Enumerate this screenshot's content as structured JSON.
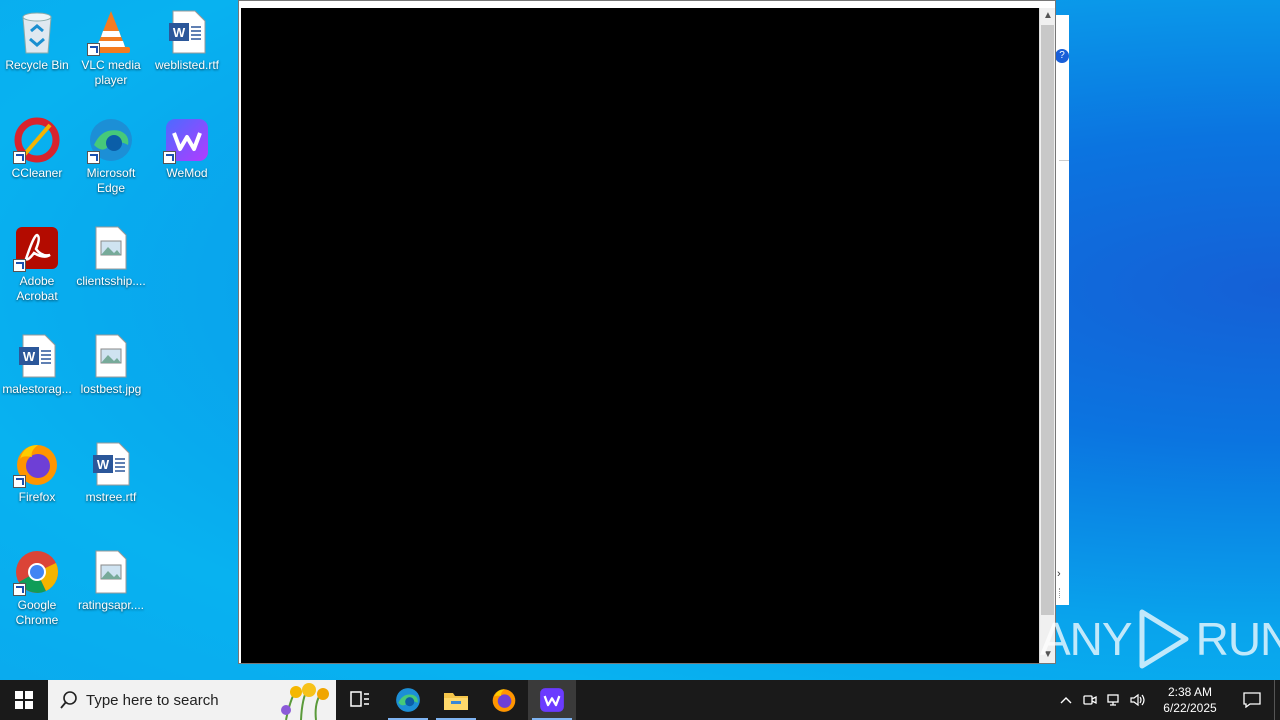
{
  "desktop": {
    "icons": [
      {
        "label": "Recycle Bin",
        "icon": "recycle-bin-icon"
      },
      {
        "label": "VLC media player",
        "icon": "vlc-icon"
      },
      {
        "label": "weblisted.rtf",
        "icon": "word-doc-icon"
      },
      {
        "label": "CCleaner",
        "icon": "ccleaner-icon"
      },
      {
        "label": "Microsoft Edge",
        "icon": "edge-icon"
      },
      {
        "label": "WeMod",
        "icon": "wemod-icon"
      },
      {
        "label": "Adobe Acrobat",
        "icon": "acrobat-icon"
      },
      {
        "label": "clientsship....",
        "icon": "image-file-icon"
      },
      {
        "label": "malestorag...",
        "icon": "word-doc-icon"
      },
      {
        "label": "lostbest.jpg",
        "icon": "image-file-icon"
      },
      {
        "label": "Firefox",
        "icon": "firefox-icon"
      },
      {
        "label": "mstree.rtf",
        "icon": "word-doc-icon"
      },
      {
        "label": "Google Chrome",
        "icon": "chrome-icon"
      },
      {
        "label": "ratingsapr....",
        "icon": "image-file-icon"
      }
    ]
  },
  "watermark": {
    "text_left": "ANY",
    "text_right": "RUN"
  },
  "taskbar": {
    "search_placeholder": "Type here to search",
    "pinned": [
      "task-view-icon",
      "edge-icon",
      "file-explorer-icon",
      "firefox-icon",
      "wemod-icon"
    ],
    "clock_time": "2:38 AM",
    "clock_date": "6/22/2025"
  },
  "colors": {
    "desktop_blue": "#0aa9ee",
    "taskbar": "#1a1a1a",
    "wemod_purple": "#6b3bff"
  }
}
